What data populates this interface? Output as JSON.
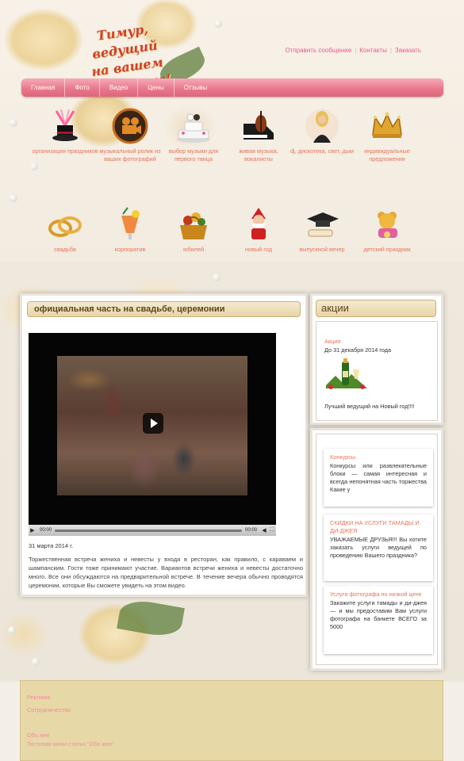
{
  "header": {
    "logo_line1": "Тимур, ведущий",
    "logo_line2": "на вашем празднике!",
    "toplinks": [
      "Отправить сообщение",
      "Контакты",
      "Заказать"
    ]
  },
  "nav": [
    "Главная",
    "Фото",
    "Видео",
    "Цены",
    "Отзывы"
  ],
  "services_row1": [
    {
      "icon": "magic-hat-icon",
      "label": "организация праздников"
    },
    {
      "icon": "film-camera-icon",
      "label": "музыкальный ролик из ваших фотографий"
    },
    {
      "icon": "wedding-cake-icon",
      "label": "выбор музыки для первого танца"
    },
    {
      "icon": "piano-violin-icon",
      "label": "живая музыка, вокалисты"
    },
    {
      "icon": "dj-woman-icon",
      "label": "dj, дискотека, свет, дым"
    },
    {
      "icon": "crown-icon",
      "label": "индивидуальные предложения"
    }
  ],
  "services_row2": [
    {
      "icon": "wedding-rings-icon",
      "label": "свадьба"
    },
    {
      "icon": "cocktail-icon",
      "label": "корпоратив"
    },
    {
      "icon": "gift-basket-icon",
      "label": "юбилей"
    },
    {
      "icon": "santa-claus-icon",
      "label": "новый год"
    },
    {
      "icon": "graduation-cap-icon",
      "label": "выпускной вечер"
    },
    {
      "icon": "teddy-bear-icon",
      "label": "детский праздник"
    }
  ],
  "main": {
    "title": "официальная часть на свадьбе, церемонии",
    "video": {
      "time_current": "00:00",
      "time_total": "00:00"
    },
    "date": "31 марта 2014 г.",
    "text": "Торжественная встреча жениха и невесты у входа в ресторан, как правило, с караваем и шампанским. Гости тоже принимают участие. Вариантов встречи жениха и невесты достаточно много. Все они обсуждаются на предварительной встрече. В течение вечера обычно проводятся церемонии, которые Вы сможете увидеть на этом видео."
  },
  "sidebar": {
    "title": "акции",
    "promo": {
      "label": "Акция",
      "date": "До 31 декабря 2014 года",
      "caption": "Лучший ведущий на Новый год!!!!"
    },
    "cards": [
      {
        "title": "Конкурсы",
        "body": "Конкурсы или развлекательные блоки — самая интересная и всегда непонятная часть торжества Какие у"
      },
      {
        "title": "СКИДКИ НА УСЛУГИ ТАМАДЫ И ДИ-ДЖЕЯ",
        "body": "УВАЖАЕМЫЕ ДРУЗЬЯ!!! Вы хотите заказать услуги ведущей по проведению Вашего праздника?"
      },
      {
        "title": "Услуги фотографа по низкой цене",
        "body": "Закажите услуги тамады и ди-джея — и мы предоставим Вам услуги фотографа на банкете ВСЕГО за 5000"
      }
    ]
  },
  "footer": {
    "links": [
      "Реклама",
      "Сотрудничество",
      "Обо мне",
      "Тестовая мини статья \"Обо мне\""
    ]
  },
  "colors": {
    "accent_pink": "#e9798d",
    "accent_orange": "#e8735a",
    "gold": "#e8d5a6"
  }
}
